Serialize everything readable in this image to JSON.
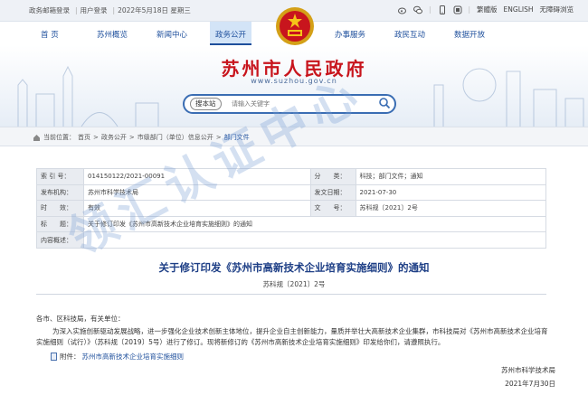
{
  "topbar": {
    "mail": "政务邮箱登录",
    "user_login": "用户登录",
    "date": "2022年5月18日 星期三",
    "traditional": "繁體版",
    "english": "ENGLISH",
    "accessibility": "无障碍浏览"
  },
  "nav": {
    "items": [
      "首 页",
      "苏州概览",
      "新闻中心",
      "政务公开",
      "办事服务",
      "政民互动",
      "数据开放"
    ]
  },
  "header": {
    "title": "苏州市人民政府",
    "url": "www.suzhou.gov.cn"
  },
  "search": {
    "button": "搜本站",
    "placeholder": "请输入关键字"
  },
  "breadcrumb": {
    "current_label": "当前位置：",
    "items": [
      "首页",
      "政务公开",
      "市级部门（单位）信息公开",
      "部门文件"
    ]
  },
  "meta": {
    "index_label": "索 引 号：",
    "index": "014150122/2021-00091",
    "category_label": "分　　类：",
    "category": "科技；部门文件；通知",
    "publisher_label": "发布机构：",
    "publisher": "苏州市科学技术局",
    "date_label": "发文日期：",
    "date": "2021-07-30",
    "validity_label": "时　　效：",
    "validity": "有效",
    "docno_label": "文　　号：",
    "docno": "苏科规〔2021〕2号",
    "title_label": "标　　题：",
    "title": "关于修订印发《苏州市高新技术企业培育实施细则》的通知",
    "summary_label": "内容概述："
  },
  "doc": {
    "title": "关于修订印发《苏州市高新技术企业培育实施细则》的通知",
    "number": "苏科规〔2021〕2号",
    "salutation": "各市、区科技局，有关单位：",
    "body": "为深入实施创新驱动发展战略，进一步强化企业技术创新主体地位，提升企业自主创新能力，量质并举壮大高新技术企业集群，市科技局对《苏州市高新技术企业培育实施细则（试行）》（苏科规〔2019〕5号）进行了修订。现将新修订的《苏州市高新技术企业培育实施细则》印发给你们，请遵照执行。",
    "attachment_label": "附件：",
    "attachment": "苏州市高新技术企业培育实施细则",
    "org": "苏州市科学技术局",
    "date": "2021年7月30日"
  },
  "watermark": "领汇认证中心",
  "icons": [
    "weibo-icon",
    "wechat-icon",
    "mobile-icon",
    "app-icon"
  ],
  "colors": {
    "accent": "#1e4f9c",
    "title_red": "#c8151d",
    "doc_title": "#1e3f86"
  }
}
